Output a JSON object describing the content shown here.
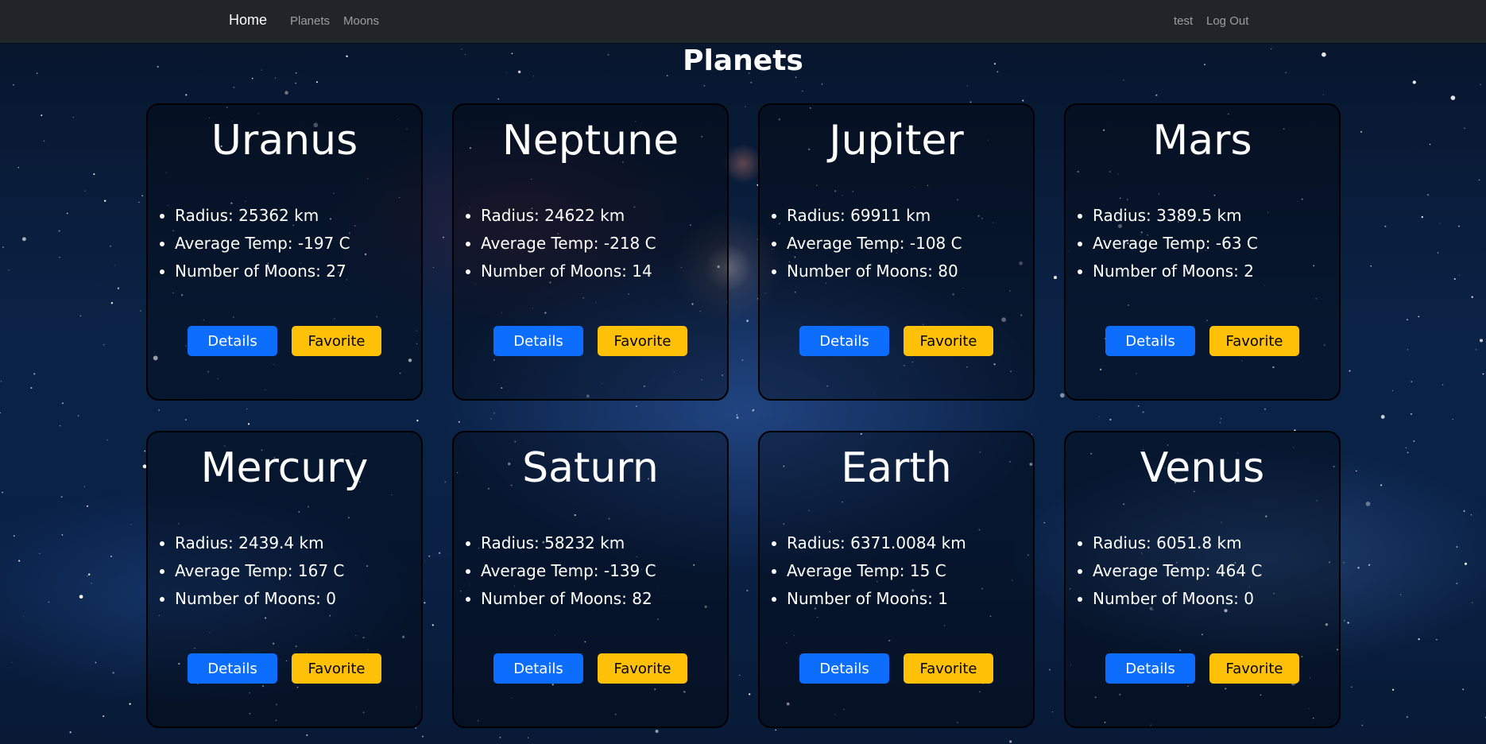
{
  "navbar": {
    "brand": "Home",
    "links": [
      "Planets",
      "Moons"
    ],
    "user": "test",
    "logout": "Log Out"
  },
  "page": {
    "title": "Planets"
  },
  "buttons": {
    "details": "Details",
    "favorite": "Favorite"
  },
  "planets": [
    {
      "name": "Uranus",
      "radius": "Radius: 25362 km",
      "temp": "Average Temp: -197 C",
      "moons": "Number of Moons: 27"
    },
    {
      "name": "Neptune",
      "radius": "Radius: 24622 km",
      "temp": "Average Temp: -218 C",
      "moons": "Number of Moons: 14"
    },
    {
      "name": "Jupiter",
      "radius": "Radius: 69911 km",
      "temp": "Average Temp: -108 C",
      "moons": "Number of Moons: 80"
    },
    {
      "name": "Mars",
      "radius": "Radius: 3389.5 km",
      "temp": "Average Temp: -63 C",
      "moons": "Number of Moons: 2"
    },
    {
      "name": "Mercury",
      "radius": "Radius: 2439.4 km",
      "temp": "Average Temp: 167 C",
      "moons": "Number of Moons: 0"
    },
    {
      "name": "Saturn",
      "radius": "Radius: 58232 km",
      "temp": "Average Temp: -139 C",
      "moons": "Number of Moons: 82"
    },
    {
      "name": "Earth",
      "radius": "Radius: 6371.0084 km",
      "temp": "Average Temp: 15 C",
      "moons": "Number of Moons: 1"
    },
    {
      "name": "Venus",
      "radius": "Radius: 6051.8 km",
      "temp": "Average Temp: 464 C",
      "moons": "Number of Moons: 0"
    }
  ]
}
